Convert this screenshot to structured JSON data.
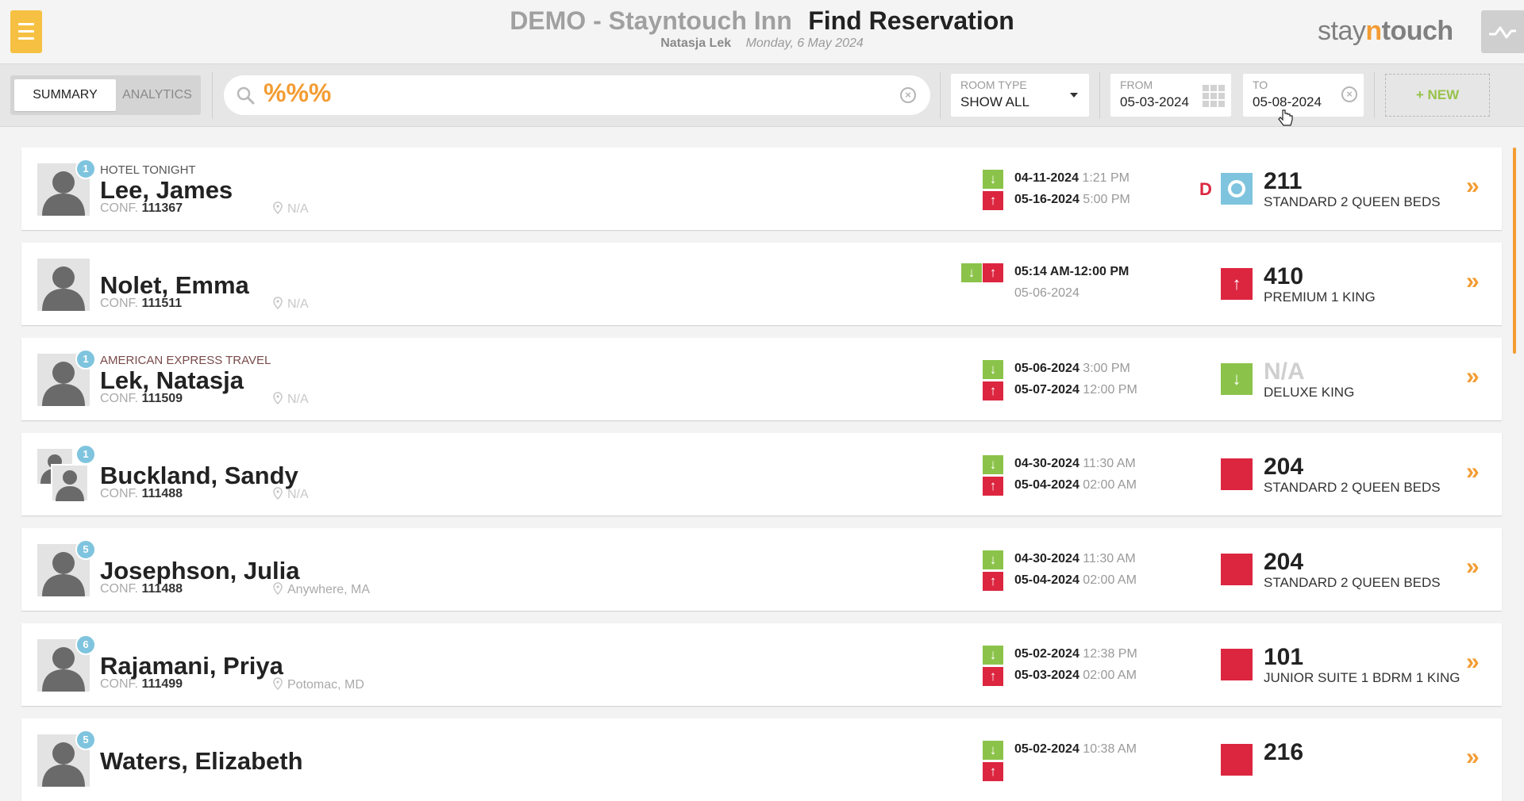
{
  "header": {
    "hotel": "DEMO - Stayntouch Inn",
    "title": "Find Reservation",
    "user": "Natasja Lek",
    "date": "Monday, 6 May 2024",
    "logo_a": "stay",
    "logo_b": "n",
    "logo_c": "touch"
  },
  "toolbar": {
    "tab_summary": "SUMMARY",
    "tab_analytics": "ANALYTICS",
    "search_value": "%%%",
    "room_type_label": "ROOM TYPE",
    "room_type_value": "SHOW ALL",
    "from_label": "FROM",
    "from_value": "05-03-2024",
    "to_label": "TO",
    "to_value": "05-08-2024",
    "new_label": "+ NEW"
  },
  "icons": {
    "menu": "hamburger-icon",
    "activity": "activity-icon",
    "search": "search-icon",
    "clear": "clear-icon",
    "calendar": "calendar-icon",
    "location": "location-pin-icon",
    "arrival": "arrow-down-icon",
    "departure": "arrow-up-icon",
    "open": "chevron-double-right-icon"
  },
  "colors": {
    "accent": "#f39c33",
    "menu": "#f6c142",
    "arrival": "#8bc34a",
    "departure": "#dc2640",
    "badge": "#7fc4de"
  },
  "reservations": [
    {
      "company": "HOTEL TONIGHT",
      "name": "Lee, James",
      "conf_label": "CONF.",
      "conf": "111367",
      "location": "N/A",
      "guests": "1",
      "arrival_date": "04-11-2024",
      "arrival_time": "1:21 PM",
      "departure_date": "05-16-2024",
      "departure_time": "5:00 PM",
      "flag": "D",
      "room": "211",
      "room_type": "STANDARD 2 QUEEN BEDS"
    },
    {
      "company": "",
      "name": "Nolet, Emma",
      "conf_label": "CONF.",
      "conf": "111511",
      "location": "N/A",
      "guests": "",
      "time_range": "05:14 AM-12:00 PM",
      "day": "05-06-2024",
      "room": "410",
      "room_type": "PREMIUM 1 KING"
    },
    {
      "company": "AMERICAN EXPRESS TRAVEL",
      "name": "Lek, Natasja",
      "conf_label": "CONF.",
      "conf": "111509",
      "location": "N/A",
      "guests": "1",
      "arrival_date": "05-06-2024",
      "arrival_time": "3:00 PM",
      "departure_date": "05-07-2024",
      "departure_time": "12:00 PM",
      "room": "N/A",
      "room_type": "DELUXE KING"
    },
    {
      "company": "",
      "name": "Buckland, Sandy",
      "conf_label": "CONF.",
      "conf": "111488",
      "location": "N/A",
      "guests": "1",
      "arrival_date": "04-30-2024",
      "arrival_time": "11:30 AM",
      "departure_date": "05-04-2024",
      "departure_time": "02:00 AM",
      "room": "204",
      "room_type": "STANDARD 2 QUEEN BEDS"
    },
    {
      "company": "",
      "name": "Josephson, Julia",
      "conf_label": "CONF.",
      "conf": "111488",
      "location": "Anywhere, MA",
      "guests": "5",
      "arrival_date": "04-30-2024",
      "arrival_time": "11:30 AM",
      "departure_date": "05-04-2024",
      "departure_time": "02:00 AM",
      "room": "204",
      "room_type": "STANDARD 2 QUEEN BEDS"
    },
    {
      "company": "",
      "name": "Rajamani, Priya",
      "conf_label": "CONF.",
      "conf": "111499",
      "location": "Potomac, MD",
      "guests": "6",
      "arrival_date": "05-02-2024",
      "arrival_time": "12:38 PM",
      "departure_date": "05-03-2024",
      "departure_time": "02:00 AM",
      "room": "101",
      "room_type": "JUNIOR SUITE 1 BDRM 1 KING"
    },
    {
      "company": "",
      "name": "Waters, Elizabeth",
      "conf_label": "",
      "conf": "",
      "location": "",
      "guests": "5",
      "arrival_date": "05-02-2024",
      "arrival_time": "10:38 AM",
      "room": "216"
    }
  ]
}
